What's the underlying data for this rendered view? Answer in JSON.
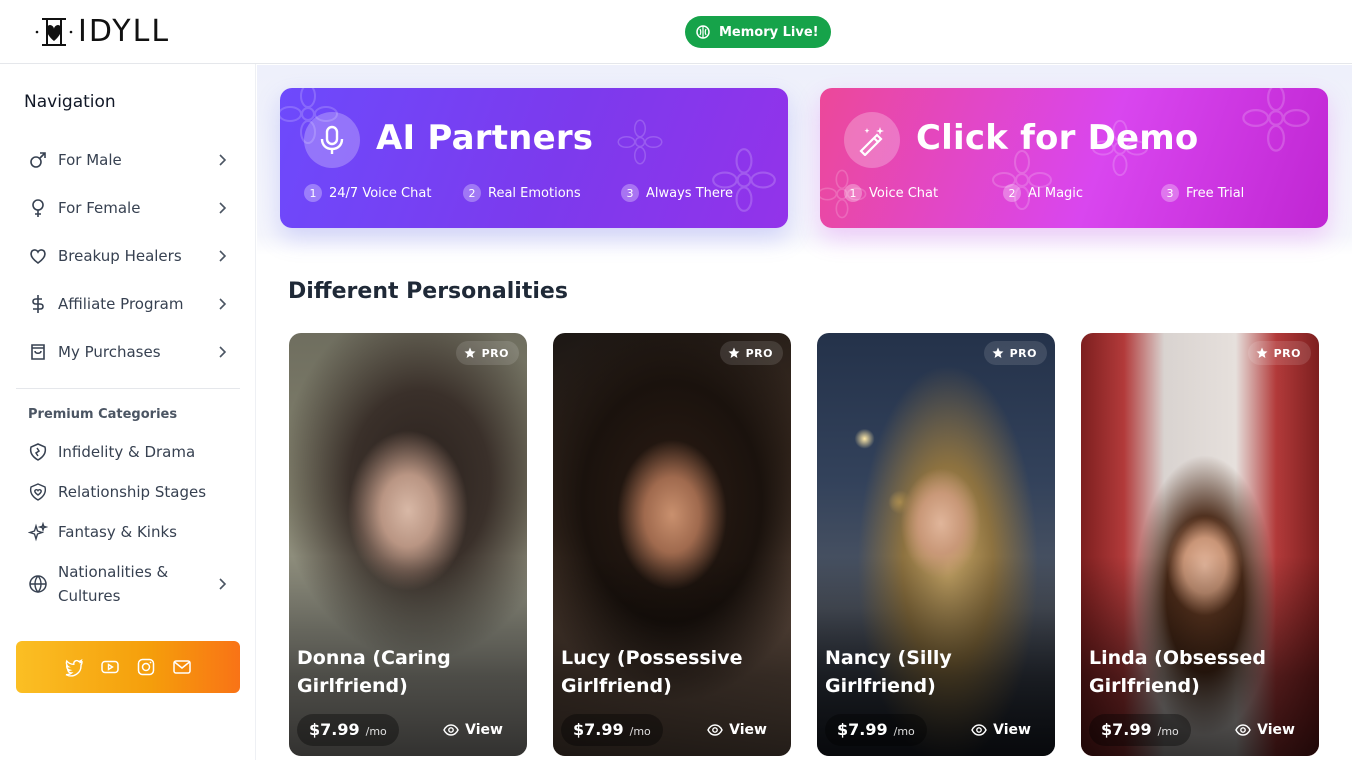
{
  "header": {
    "logo_text": "IDYLL",
    "memory_label": "Memory Live!",
    "memory_color": "#16a34a"
  },
  "sidebar": {
    "title": "Navigation",
    "items": [
      {
        "label": "For Male",
        "icon": "male-icon"
      },
      {
        "label": "For Female",
        "icon": "female-icon"
      },
      {
        "label": "Breakup Healers",
        "icon": "heart-icon"
      },
      {
        "label": "Affiliate Program",
        "icon": "dollar-icon"
      },
      {
        "label": "My Purchases",
        "icon": "shopping-bag-icon"
      }
    ],
    "premium_title": "Premium Categories",
    "premium_items": [
      {
        "label": "Infidelity & Drama",
        "icon": "broken-shield-icon"
      },
      {
        "label": "Relationship Stages",
        "icon": "heart-shield-icon"
      },
      {
        "label": "Fantasy & Kinks",
        "icon": "sparkles-icon"
      },
      {
        "label": "Nationalities & Cultures",
        "label_line1": "Nationalities &",
        "label_line2": "Cultures",
        "icon": "globe-icon"
      }
    ],
    "social_icons": [
      "twitter-icon",
      "youtube-icon",
      "instagram-icon",
      "mail-icon"
    ]
  },
  "banners": [
    {
      "title": "AI Partners",
      "icon": "microphone-icon",
      "features": [
        {
          "num": "1",
          "label": "24/7 Voice Chat"
        },
        {
          "num": "2",
          "label": "Real Emotions"
        },
        {
          "num": "3",
          "label": "Always There"
        }
      ]
    },
    {
      "title": "Click for Demo",
      "icon": "magic-wand-icon",
      "features": [
        {
          "num": "1",
          "label": "Voice Chat"
        },
        {
          "num": "2",
          "label": "AI Magic"
        },
        {
          "num": "3",
          "label": "Free Trial"
        }
      ]
    }
  ],
  "section_title": "Different Personalities",
  "cards": [
    {
      "badge": "PRO",
      "name": "Donna (Caring Girlfriend)",
      "price": "$7.99",
      "per": "/mo",
      "view": "View"
    },
    {
      "badge": "PRO",
      "name": "Lucy (Possessive Girlfriend)",
      "price": "$7.99",
      "per": "/mo",
      "view": "View"
    },
    {
      "badge": "PRO",
      "name": "Nancy (Silly Girlfriend)",
      "price": "$7.99",
      "per": "/mo",
      "view": "View"
    },
    {
      "badge": "PRO",
      "name": "Linda (Obsessed Girlfriend)",
      "price": "$7.99",
      "per": "/mo",
      "view": "View"
    }
  ]
}
